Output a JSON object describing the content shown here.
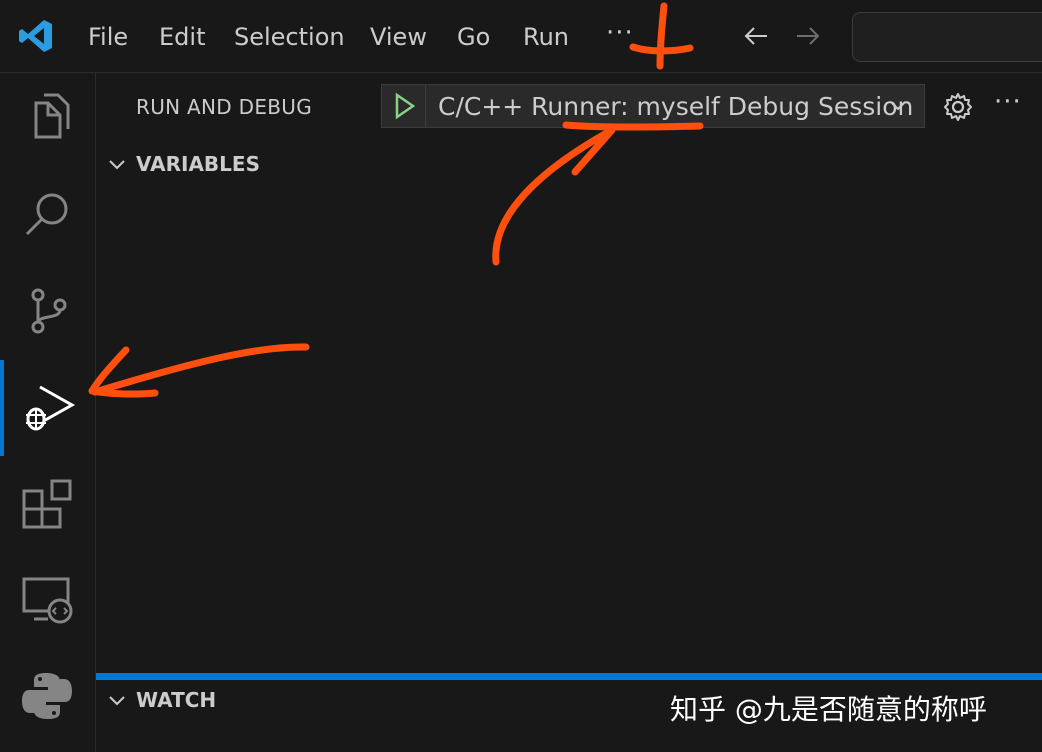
{
  "menubar": {
    "items": [
      "File",
      "Edit",
      "Selection",
      "View",
      "Go",
      "Run"
    ],
    "more": "···"
  },
  "icons": {
    "logo": "vscode-logo-icon",
    "back": "arrow-left-icon",
    "forward": "arrow-right-icon",
    "explorer": "files-icon",
    "search": "search-icon",
    "scm": "source-control-icon",
    "debug": "run-debug-icon",
    "extensions": "extensions-icon",
    "remote": "remote-explorer-icon",
    "python": "python-icon"
  },
  "sidebar": {
    "title": "RUN AND DEBUG",
    "config_label": "C/C++ Runner: myself Debug Session",
    "more": "···",
    "sections": {
      "variables": "VARIABLES",
      "watch": "WATCH"
    }
  },
  "watermark": "知乎 @九是否随意的称呼",
  "colors": {
    "background": "#181818",
    "accent": "#0078d4",
    "run_green": "#89d185",
    "annotation": "#ff4f0f"
  }
}
